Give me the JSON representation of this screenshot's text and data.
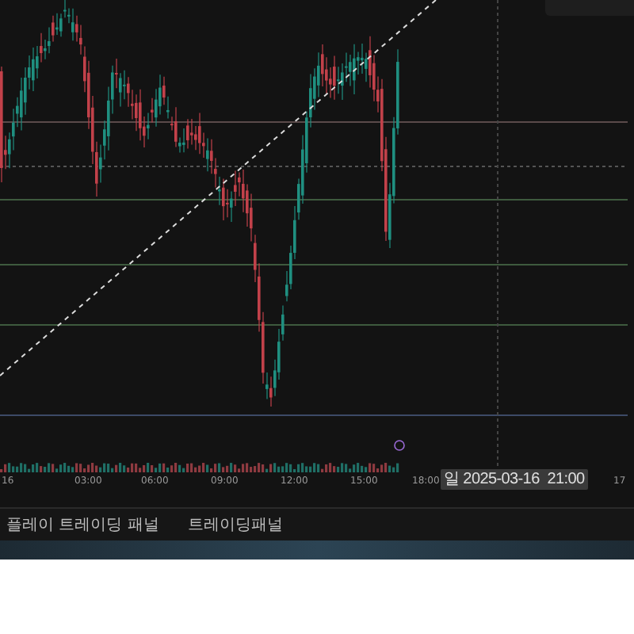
{
  "time_axis": {
    "labels": [
      "16",
      "03:00",
      "06:00",
      "09:00",
      "12:00",
      "15:00",
      "18:00",
      "17"
    ]
  },
  "cursor_date": "일 2025-03-16  21:00",
  "tabs": [
    {
      "label": "플레이 트레이딩 패널",
      "selected": false
    },
    {
      "label": "트레이딩패널",
      "selected": false
    }
  ]
}
